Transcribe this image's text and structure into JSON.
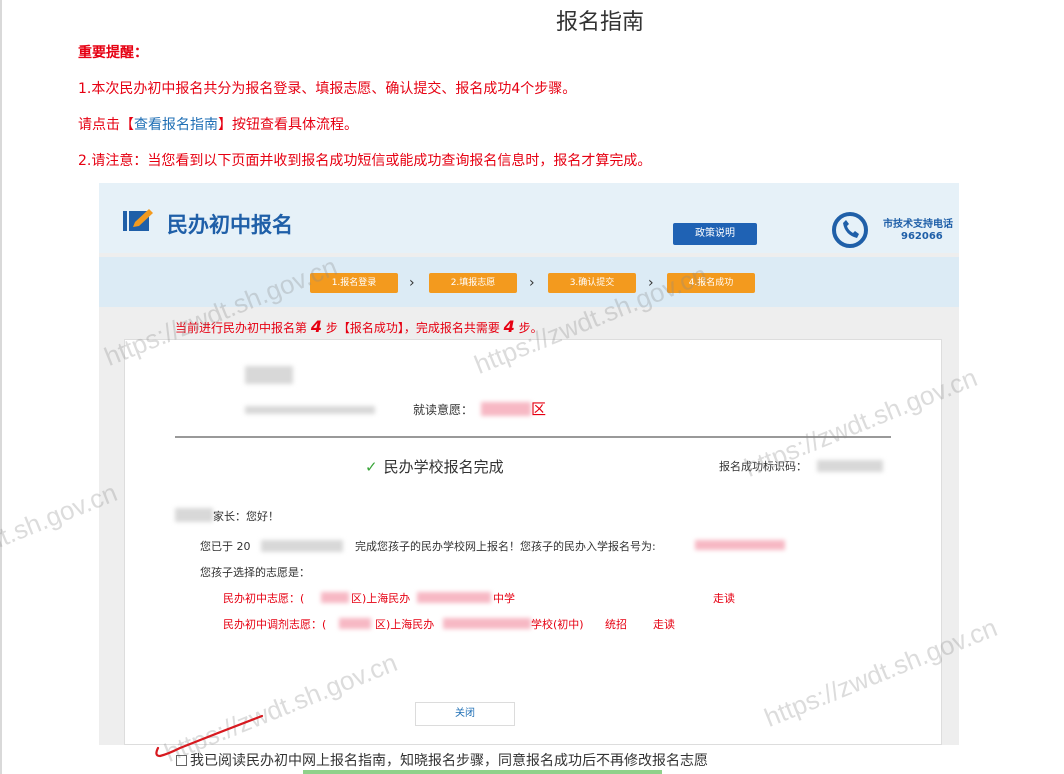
{
  "page": {
    "title": "报名指南",
    "notice_heading": "重要提醒：",
    "notice_line1": "1.本次民办初中报名共分为报名登录、填报志愿、确认提交、报名成功4个步骤。",
    "notice_line2_prefix": "请点击【",
    "notice_line2_link": "查看报名指南",
    "notice_line2_suffix": "】按钮查看具体流程。",
    "notice_line3": "2.请注意：当您看到以下页面并收到报名成功短信或能成功查询报名信息时，报名才算完成。",
    "agree_text": "我已阅读民办初中网上报名指南，知晓报名步骤，同意报名成功后不再修改报名志愿"
  },
  "screenshot": {
    "site_title": "民办初中报名",
    "policy_button": "政策说明",
    "support_label": "市技术支持电话",
    "support_phone": "962066",
    "steps": [
      "1.报名登录",
      "2.填报志愿",
      "3.确认提交",
      "4.报名成功"
    ],
    "step_arrow": "›",
    "progress_prefix": "当前进行民办初中报名第",
    "progress_step": "4",
    "progress_middle": "步【报名成功】，完成报名共需要",
    "progress_total": "4",
    "progress_suffix": "步。",
    "intent_label": "就读意愿：",
    "intent_value": "区",
    "complete_check": "✓",
    "complete_title": "民办学校报名完成",
    "code_label": "报名成功标识码：",
    "greeting": "家长：您好！",
    "line1_prefix": "您已于 20",
    "line1_rest": "完成您孩子的民办学校网上报名！您孩子的民办入学报名号为:",
    "line2": "您孩子选择的志愿是：",
    "choice1_label": "民办初中志愿：(",
    "choice1_district": "区)上海民办",
    "choice1_school": "中学",
    "choice1_mode": "走读",
    "choice2_label": "民办初中调剂志愿：(",
    "choice2_district": "区)上海民办",
    "choice2_school": "学校(初中)",
    "choice2_type": "统招",
    "choice2_mode": "走读",
    "close_button": "关闭"
  },
  "watermark": "https://zwdt.sh.gov.cn",
  "colors": {
    "alert_red": "#e60012",
    "link_blue": "#1f6fb5",
    "brand_blue": "#1f5fa8",
    "step_orange": "#f39a1e"
  }
}
